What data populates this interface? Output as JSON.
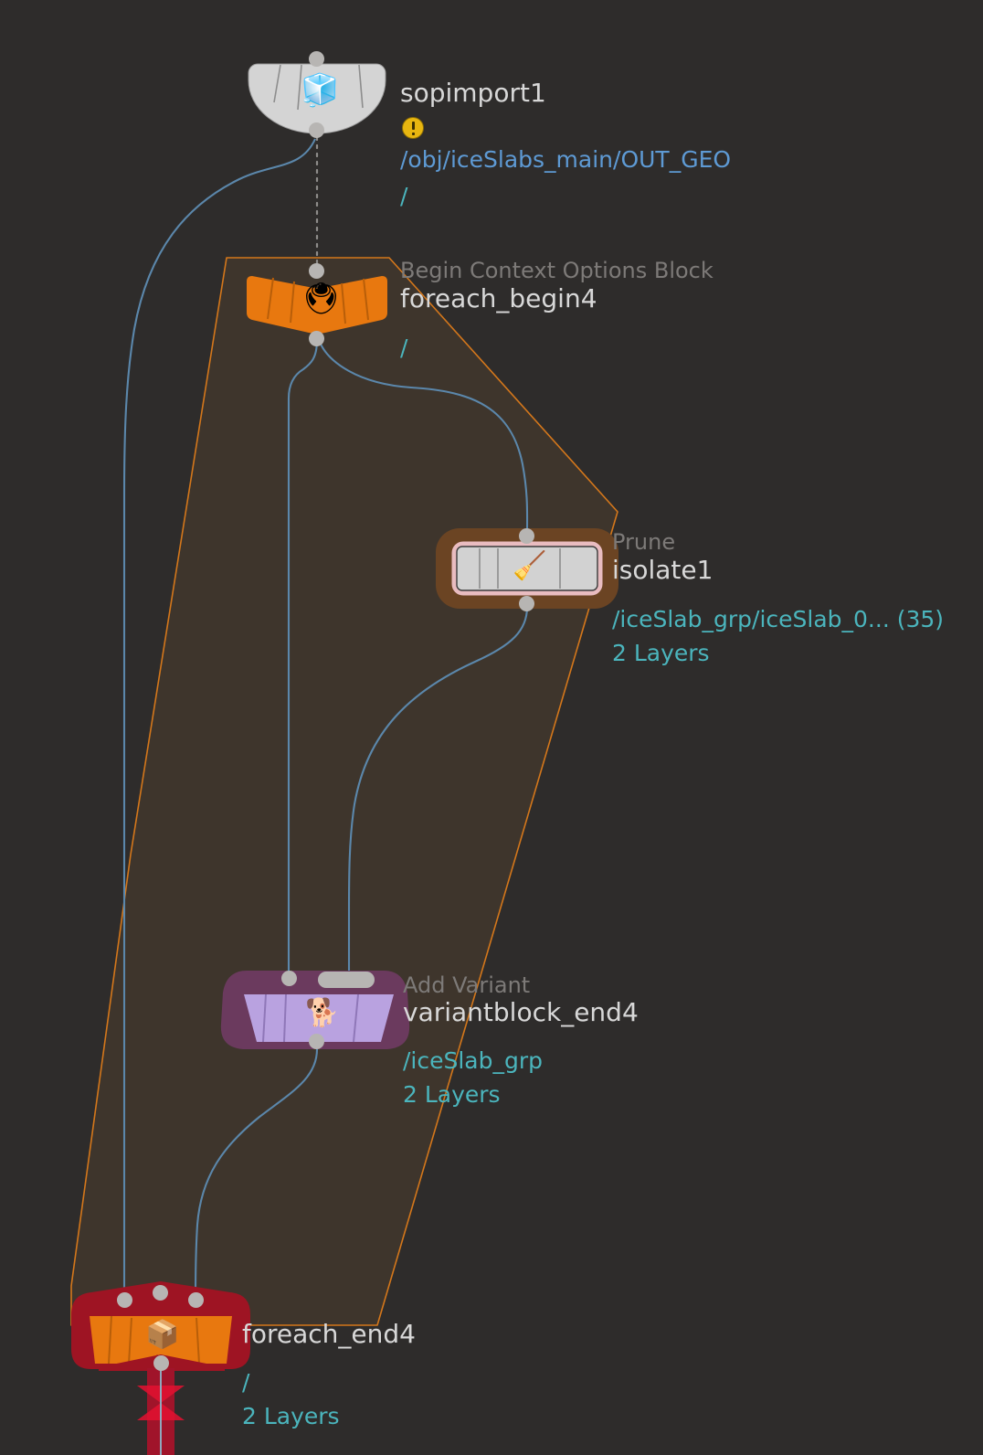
{
  "app": {
    "view": "node-graph",
    "background_color": "#2e2c2b"
  },
  "colors": {
    "background": "#2e2c2b",
    "block_fill": "#3e352c",
    "block_outline": "#d4771b",
    "wire": "#5b87ab",
    "connector": "#b7b5b3",
    "node_name_text": "#d8d8d8",
    "node_subtitle_text": "#7d7a78",
    "path_blue": "#5e9ad4",
    "path_teal": "#4bb5bd",
    "warning_badge": "#e8b610",
    "selection_outline": "#e9bcc0",
    "selection_halo": "#6b4423",
    "display_flag": "#9e1423",
    "variant_node": "#b9a2e0",
    "variant_halo": "#6b3a5e",
    "orange_node": "#e8780f",
    "import_node": "#cfcfcf"
  },
  "nodes": [
    {
      "id": "sopimport1",
      "name": "sopimport1",
      "subtitle": "",
      "icon": "sop-import-icon",
      "icon_glyph": "🧊",
      "shape": "half-moon",
      "color": "#cfcfcf",
      "has_warning": true,
      "warning_icon": "warning-badge-icon",
      "paths": [
        {
          "text": "/obj/iceSlabs_main/OUT_GEO",
          "style": "blue"
        },
        {
          "text": "/",
          "style": "teal"
        }
      ]
    },
    {
      "id": "foreach_begin4",
      "name": "foreach_begin4",
      "subtitle": "Begin Context Options Block",
      "icon": "foreach-begin-icon",
      "icon_glyph": "🖲",
      "shape": "butterfly",
      "color": "#e8780f",
      "has_warning": false,
      "paths": [
        {
          "text": "/",
          "style": "teal"
        }
      ]
    },
    {
      "id": "isolate1",
      "name": "isolate1",
      "subtitle": "Prune",
      "icon": "broom-icon",
      "icon_glyph": "🧹",
      "shape": "rounded-rect",
      "color": "#cfcfcf",
      "selected": true,
      "has_warning": false,
      "paths": [
        {
          "text": "/iceSlab_grp/iceSlab_0... (35)",
          "style": "teal"
        },
        {
          "text": "2 Layers",
          "style": "teal"
        }
      ]
    },
    {
      "id": "variantblock_end4",
      "name": "variantblock_end4",
      "subtitle": "Add Variant",
      "icon": "add-variant-icon",
      "icon_glyph": "🐕",
      "shape": "trapezoid",
      "color": "#b9a2e0",
      "has_warning": false,
      "paths": [
        {
          "text": "/iceSlab_grp",
          "style": "teal"
        },
        {
          "text": "2 Layers",
          "style": "teal"
        }
      ]
    },
    {
      "id": "foreach_end4",
      "name": "foreach_end4",
      "subtitle": "",
      "icon": "foreach-end-icon",
      "icon_glyph": "📦",
      "shape": "chevron-trapezoid",
      "color": "#e8780f",
      "display_flag": true,
      "has_warning": false,
      "paths": [
        {
          "text": "/",
          "style": "teal"
        },
        {
          "text": "2 Layers",
          "style": "teal"
        }
      ]
    }
  ],
  "block": {
    "label": "foreach-loop-block",
    "outline_color": "#d4771b",
    "fill_color": "#3e352c"
  }
}
